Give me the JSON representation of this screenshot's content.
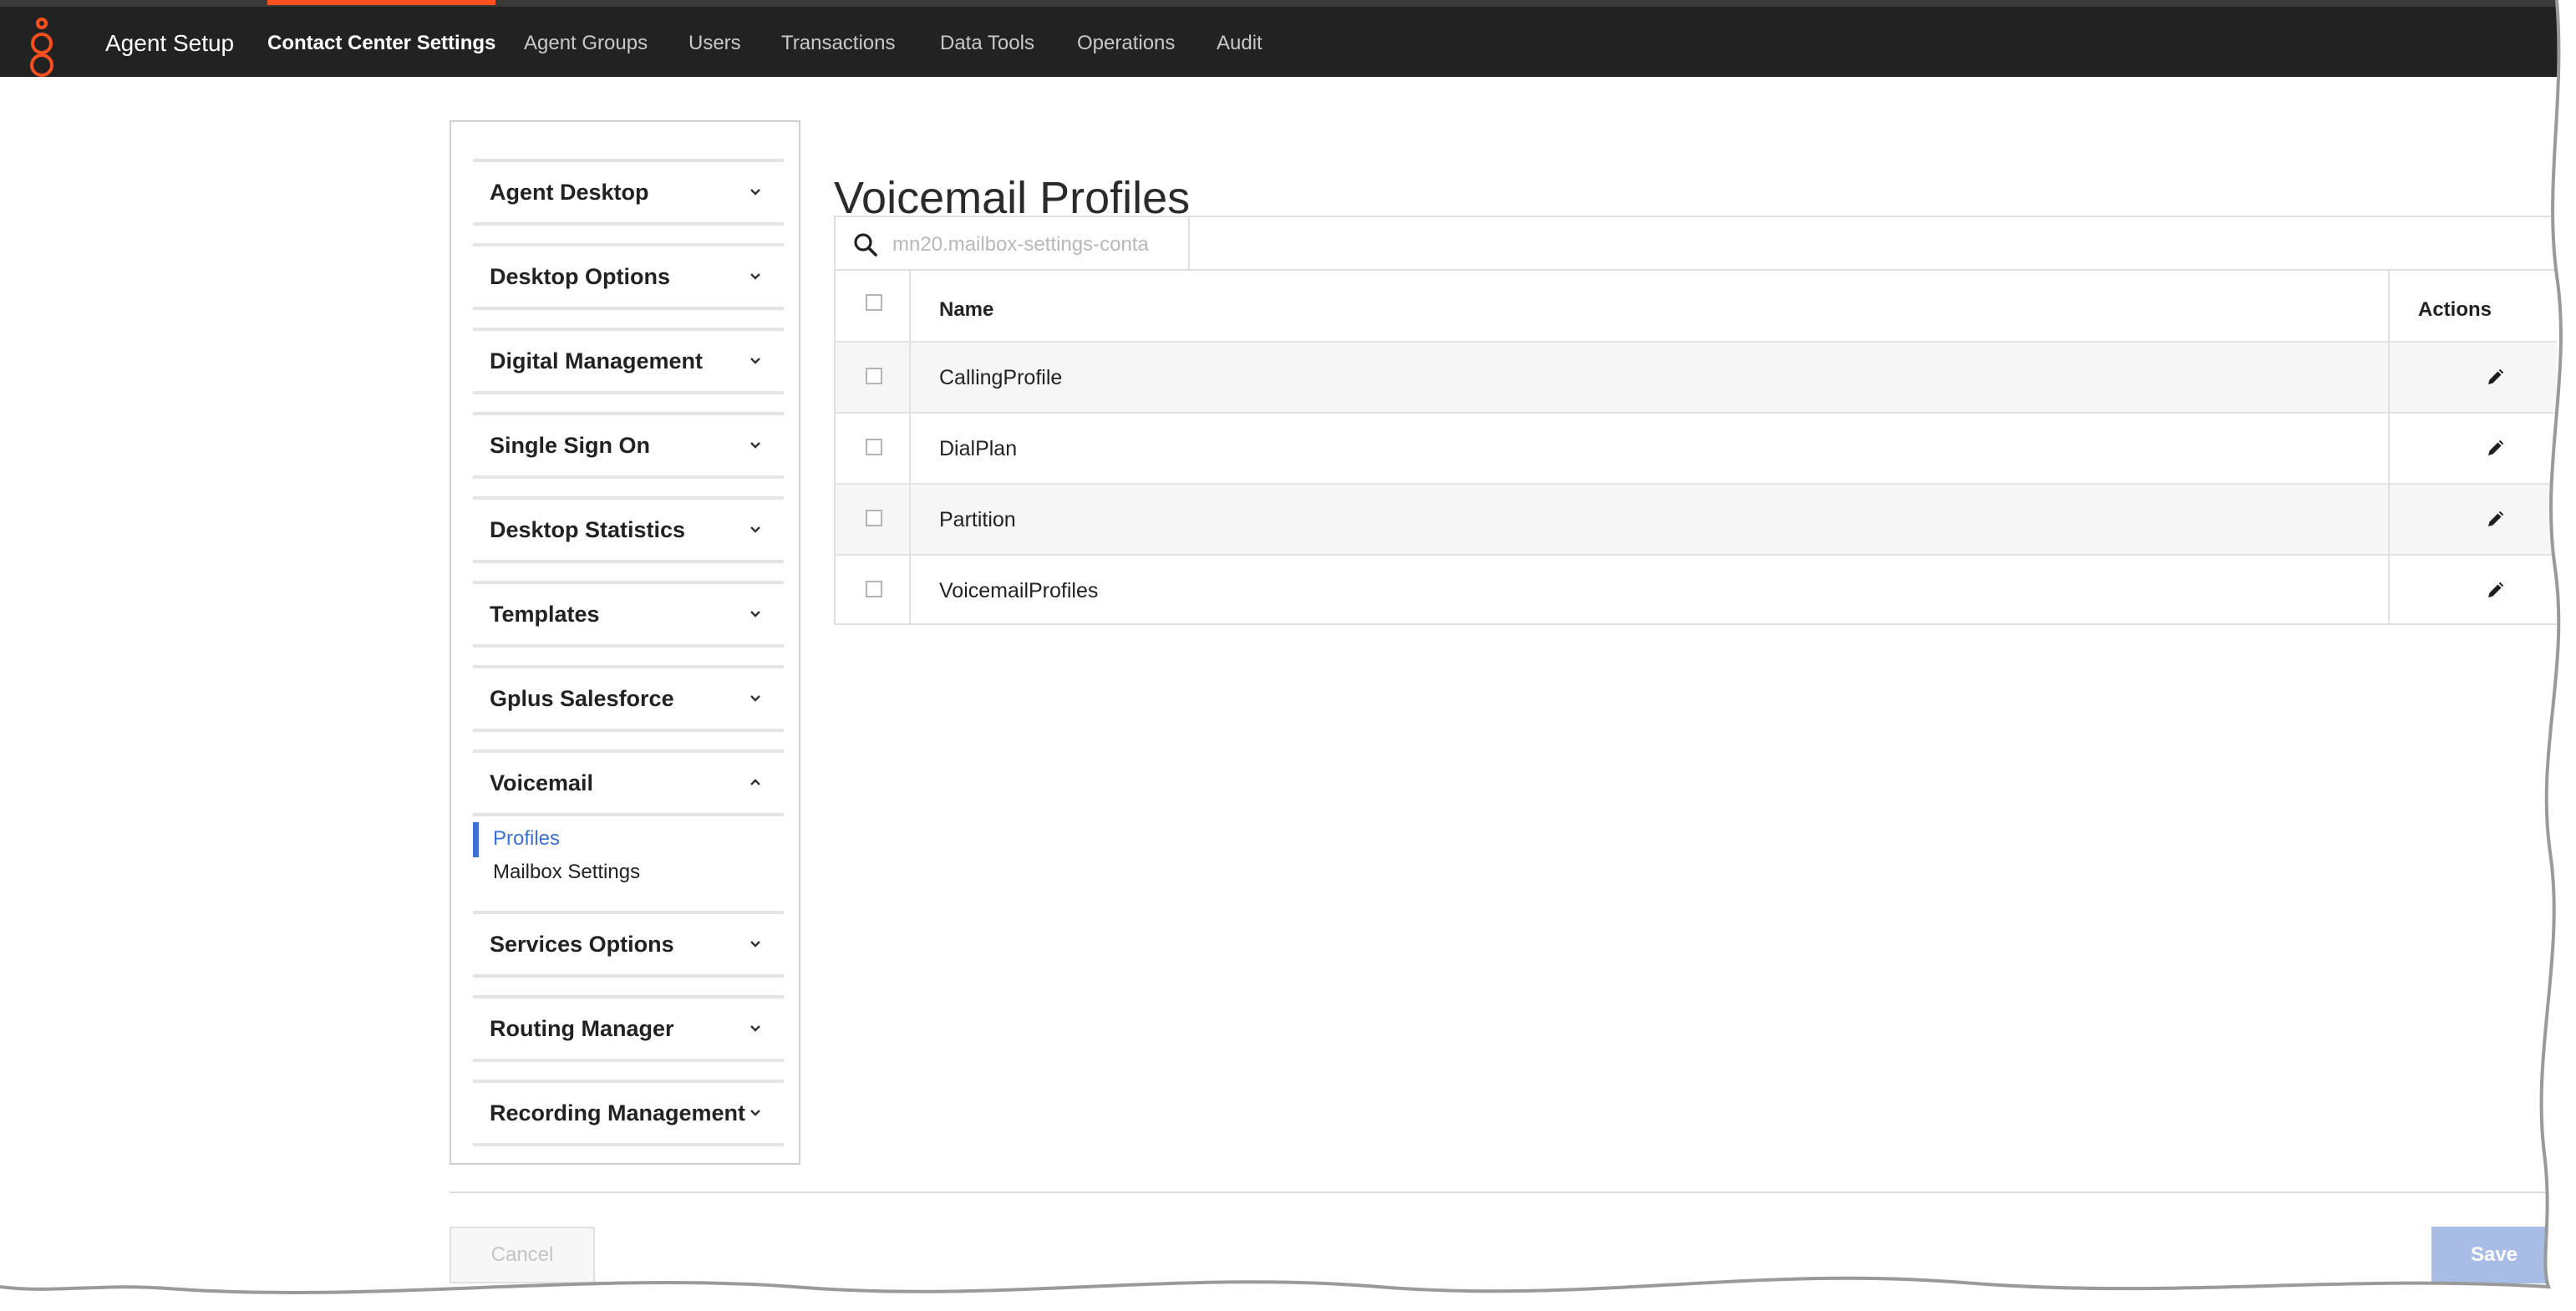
{
  "topbar": {
    "app_title": "Agent Setup",
    "tabs": [
      {
        "label": "Contact Center Settings",
        "active": true
      },
      {
        "label": "Agent Groups",
        "active": false
      },
      {
        "label": "Users",
        "active": false
      },
      {
        "label": "Transactions",
        "active": false
      },
      {
        "label": "Data Tools",
        "active": false
      },
      {
        "label": "Operations",
        "active": false
      },
      {
        "label": "Audit",
        "active": false
      }
    ]
  },
  "sidebar": {
    "sections": [
      {
        "label": "Agent Desktop",
        "expanded": false
      },
      {
        "label": "Desktop Options",
        "expanded": false
      },
      {
        "label": "Digital Management",
        "expanded": false
      },
      {
        "label": "Single Sign On",
        "expanded": false
      },
      {
        "label": "Desktop Statistics",
        "expanded": false
      },
      {
        "label": "Templates",
        "expanded": false
      },
      {
        "label": "Gplus Salesforce",
        "expanded": false
      },
      {
        "label": "Voicemail",
        "expanded": true
      },
      {
        "label": "Services Options",
        "expanded": false
      },
      {
        "label": "Routing Manager",
        "expanded": false
      },
      {
        "label": "Recording Management",
        "expanded": false
      }
    ],
    "voicemail_items": [
      {
        "label": "Profiles",
        "active": true
      },
      {
        "label": "Mailbox Settings",
        "active": false
      }
    ]
  },
  "main": {
    "title": "Voicemail Profiles",
    "search": {
      "placeholder": "mn20.mailbox-settings-conta",
      "value": ""
    },
    "table": {
      "headers": {
        "name": "Name",
        "actions": "Actions"
      },
      "rows": [
        {
          "name": "CallingProfile"
        },
        {
          "name": "DialPlan"
        },
        {
          "name": "Partition"
        },
        {
          "name": "VoicemailProfiles"
        }
      ]
    }
  },
  "footer": {
    "cancel_label": "Cancel",
    "save_label": "Save"
  },
  "colors": {
    "topbar_bg": "#222222",
    "accent": "#ff4f1f",
    "link_active": "#3b6fd1",
    "save_button": "#a7bde6"
  }
}
